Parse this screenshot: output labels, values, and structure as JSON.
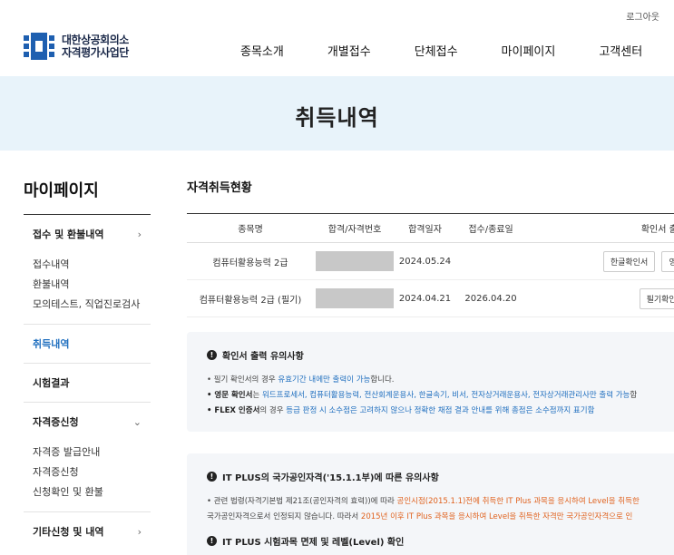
{
  "header": {
    "logout": "로그아웃",
    "logo_line1": "대한상공회의소",
    "logo_line2": "자격평가사업단",
    "nav": [
      "종목소개",
      "개별접수",
      "단체접수",
      "마이페이지",
      "고객센터"
    ]
  },
  "hero": {
    "title": "취득내역"
  },
  "sidebar": {
    "title": "마이페이지",
    "groups": [
      {
        "label": "접수 및 환불내역",
        "chev": "›",
        "items": [
          "접수내역",
          "환불내역",
          "모의테스트, 직업진로검사"
        ]
      },
      {
        "label": "취득내역"
      },
      {
        "label": "시험결과"
      },
      {
        "label": "자격증신청",
        "chev": "⌄",
        "items": [
          "자격증 발급안내",
          "자격증신청",
          "신청확인 및 환불"
        ]
      },
      {
        "label": "기타신청 및 내역",
        "chev": "›"
      }
    ]
  },
  "main": {
    "title": "자격취득현황",
    "table": {
      "headers": [
        "종목명",
        "합격/자격번호",
        "합격일자",
        "접수/종료일",
        "확인서 출력"
      ],
      "rows": [
        {
          "name": "컴퓨터활용능력 2급",
          "date": "2024.05.24",
          "end": "",
          "btn1": "한글확인서",
          "btn2": "영문"
        },
        {
          "name": "컴퓨터활용능력 2급 (필기)",
          "date": "2024.04.21",
          "end": "2026.04.20",
          "btn1": "필기확인서"
        }
      ]
    }
  },
  "notice1": {
    "title": "확인서 출력 유의사항",
    "l1a": "• 필기 확인서의 경우 ",
    "l1b": "유효기간 내에만 출력이 가능",
    "l1c": "합니다.",
    "l2a": "• 영문 확인서",
    "l2b": "는 ",
    "l2c": "워드프로세서, 컴퓨터활용능력, 전산회계운용사, 한글속기, 비서, 전자상거래운용사, 전자상거래관리사만 출력 가능",
    "l2d": "합",
    "l3a": "• FLEX 인증서",
    "l3b": "의 경우 ",
    "l3c": "등급 판정 시 소수점은 고려하지 않으나 정확한 채점 결과 안내를 위해 총점은 소수점까지 표기함"
  },
  "notice2": {
    "title": "IT PLUS의 국가공인자격('15.1.1부)에 따른 유의사항",
    "l1a": "• 관련 법령(자격기본법 제21조(공인자격의 효력))에 따라 ",
    "l1b": "공인시점(2015.1.1)전에 취득한 IT Plus 과목을 응시하여 Level을 취득한",
    "l2a": "  국가공인자격으로서 인정되지 않습니다. 따라서 ",
    "l2b": "2015년 이후 IT Plus 과목을 응시하여 Level을 취득한 자격만 국가공인자격으로 인",
    "title2": "IT PLUS 시험과목 면제 및 레벨(Level) 확인"
  },
  "colors": {
    "accent": "#1f6fbf",
    "hero_bg": "#e8f3fa",
    "warn": "#e0621e"
  }
}
